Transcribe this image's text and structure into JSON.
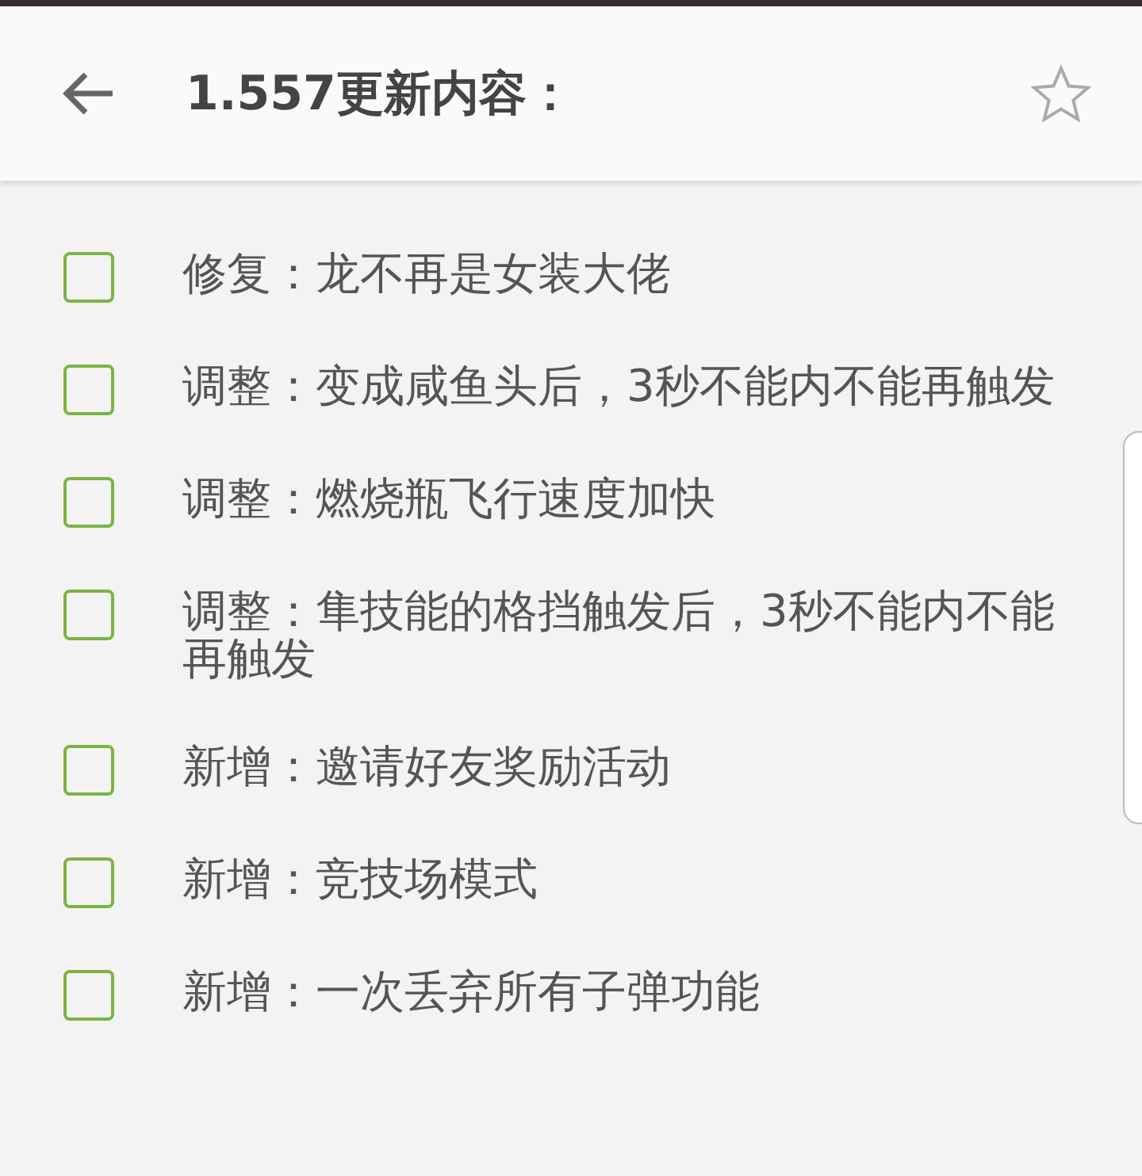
{
  "header": {
    "title": "1.557更新内容：",
    "starred": false
  },
  "items": [
    {
      "text": "修复：龙不再是女装大佬",
      "checked": false
    },
    {
      "text": "调整：变成咸鱼头后，3秒不能内不能再触发",
      "checked": false
    },
    {
      "text": "调整：燃烧瓶飞行速度加快",
      "checked": false
    },
    {
      "text": "调整：隼技能的格挡触发后，3秒不能内不能再触发",
      "checked": false
    },
    {
      "text": "新增：邀请好友奖励活动",
      "checked": false
    },
    {
      "text": "新增：竞技场模式",
      "checked": false
    },
    {
      "text": "新增：一次丢弃所有子弹功能",
      "checked": false
    }
  ]
}
